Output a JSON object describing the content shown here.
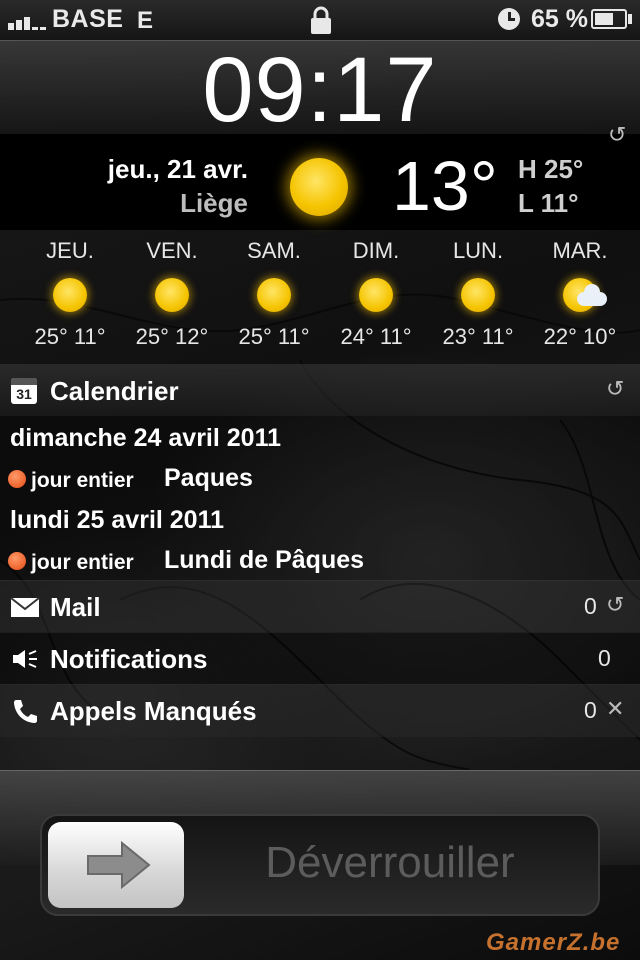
{
  "status_bar": {
    "carrier": "BASE",
    "network": "E",
    "battery": "65 %",
    "battery_level": 0.65
  },
  "lock_screen": {
    "time": "09:17"
  },
  "weather": {
    "date": "jeu., 21 avr.",
    "city": "Liège",
    "condition_icon": "sun-icon",
    "temperature": "13°",
    "high": "H 25°",
    "low": "L 11°",
    "forecast": [
      {
        "day": "JEU.",
        "icon": "sun-icon",
        "temps": "25° 11°"
      },
      {
        "day": "VEN.",
        "icon": "sun-icon",
        "temps": "25° 12°"
      },
      {
        "day": "SAM.",
        "icon": "sun-icon",
        "temps": "25° 11°"
      },
      {
        "day": "DIM.",
        "icon": "sun-icon",
        "temps": "24° 11°"
      },
      {
        "day": "LUN.",
        "icon": "sun-icon",
        "temps": "23° 11°"
      },
      {
        "day": "MAR.",
        "icon": "partly-cloudy-icon",
        "temps": "22° 10°"
      }
    ]
  },
  "calendar": {
    "title": "Calendrier",
    "icon_day": "31",
    "events": [
      {
        "date": "dimanche 24 avril 2011",
        "when": "jour entier",
        "name": "Paques"
      },
      {
        "date": "lundi 25 avril 2011",
        "when": "jour entier",
        "name": "Lundi de Pâques"
      }
    ]
  },
  "rows": [
    {
      "title": "Mail",
      "count": "0",
      "icon": "mail-icon",
      "action_icon": "refresh-icon"
    },
    {
      "title": "Notifications",
      "count": "0",
      "icon": "speaker-icon",
      "action_icon": ""
    },
    {
      "title": "Appels Manqués",
      "count": "0",
      "icon": "phone-icon",
      "action_icon": "close-icon"
    }
  ],
  "unlock": {
    "label": "Déverrouiller"
  },
  "watermark": "GamerZ.be",
  "colors": {
    "accent_orange": "#e64a10",
    "sun_yellow": "#f5c400",
    "watermark": "#c6722e"
  }
}
